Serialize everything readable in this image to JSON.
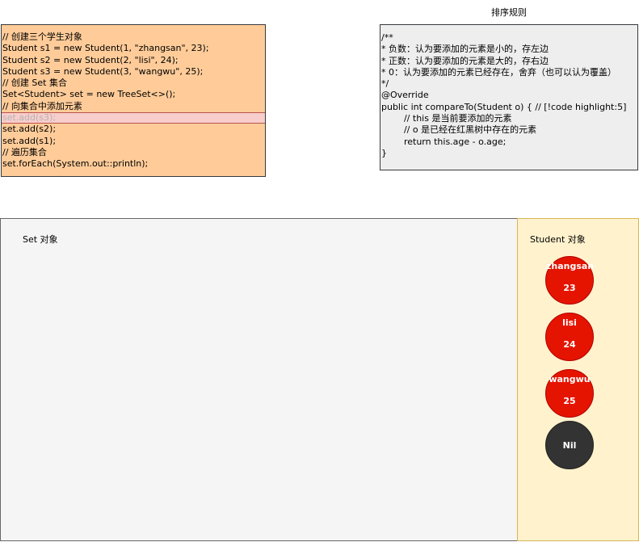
{
  "code": {
    "lines": [
      "// 创建三个学生对象",
      "Student s1 = new Student(1, \"zhangsan\", 23);",
      "Student s2 = new Student(2, \"lisi\", 24);",
      "Student s3 = new Student(3, \"wangwu\", 25);",
      "// 创建 Set 集合",
      "Set<Student> set = new TreeSet<>();",
      "// 向集合中添加元素",
      "set.add(s3);",
      "set.add(s2);",
      "set.add(s1);",
      "// 遍历集合",
      "set.forEach(System.out::println);"
    ],
    "highlight_line": 7
  },
  "rules": {
    "title": "排序规则",
    "lines": [
      "/**",
      "* 负数：认为要添加的元素是小的，存左边",
      "* 正数：认为要添加的元素是大的，存右边",
      "* 0：认为要添加的元素已经存在，舍弃（也可以认为覆盖）",
      "*/",
      "@Override",
      "public int compareTo(Student o) { // [!code highlight:5]",
      "        // this 是当前要添加的元素",
      "        // o 是已经在红黑树中存在的元素",
      "        return this.age - o.age;",
      "}"
    ]
  },
  "set_panel": {
    "label": "Set 对象"
  },
  "student_panel": {
    "label": "Student 对象",
    "students": [
      {
        "name": "zhangsan",
        "age": "23"
      },
      {
        "name": "lisi",
        "age": "24"
      },
      {
        "name": "wangwu",
        "age": "25"
      }
    ],
    "nil_label": "Nil"
  },
  "colors": {
    "code_bg": "#ffcc99",
    "rule_bg": "#eeeeee",
    "set_bg": "#f5f5f5",
    "student_bg": "#fff2cc",
    "node_red": "#e51400",
    "node_nil": "#333333"
  }
}
